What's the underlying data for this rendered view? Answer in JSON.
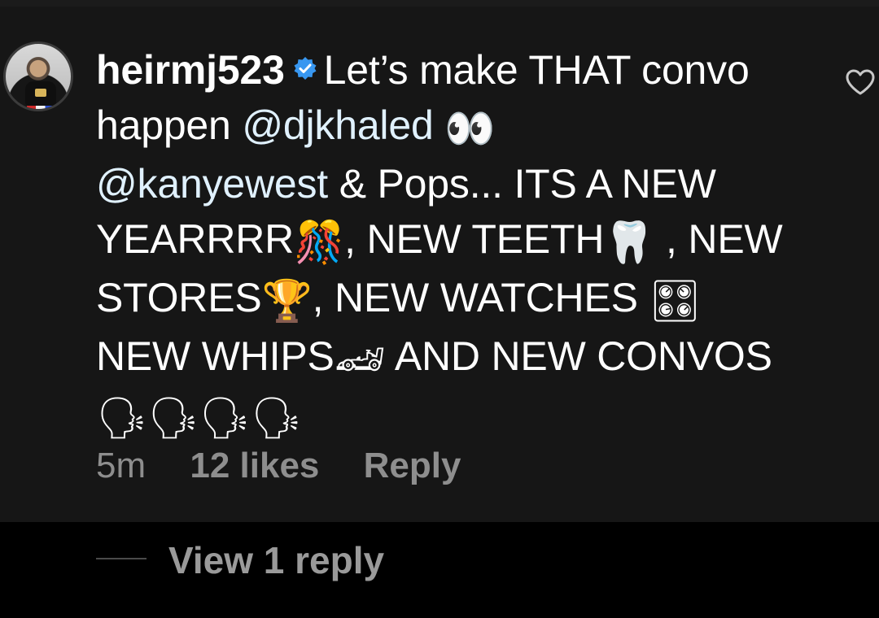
{
  "comment": {
    "username": "heirmj523",
    "text_parts": {
      "p1": "Let’s make THAT convo happen ",
      "mention1": "@djkhaled",
      "emoji1": "👀",
      "mention2": "@kanyewest",
      "p2": " & Pops... ITS A NEW YEARRRR",
      "emoji2": "🎊",
      "p3": ", NEW TEETH",
      "emoji3": "🦷",
      "p4": " , NEW STORES",
      "emoji4": "🏆",
      "p5": ", NEW WATCHES ",
      "emoji5": "🎛",
      "p6": " NEW WHIPS",
      "emoji6": "🏎",
      "p7": "  AND NEW CONVOS",
      "emoji7": "🗣🗣🗣🗣"
    },
    "time": "5m",
    "likes": "12 likes",
    "reply_label": "Reply",
    "verified_icon": "verified-badge-icon",
    "like_icon": "heart-icon"
  },
  "replies": {
    "view_label": "View 1 reply"
  },
  "colors": {
    "background": "#161616",
    "text": "#ffffff",
    "mention": "#e0f1ff",
    "meta": "#8e8e8e",
    "verified": "#3897f0"
  }
}
